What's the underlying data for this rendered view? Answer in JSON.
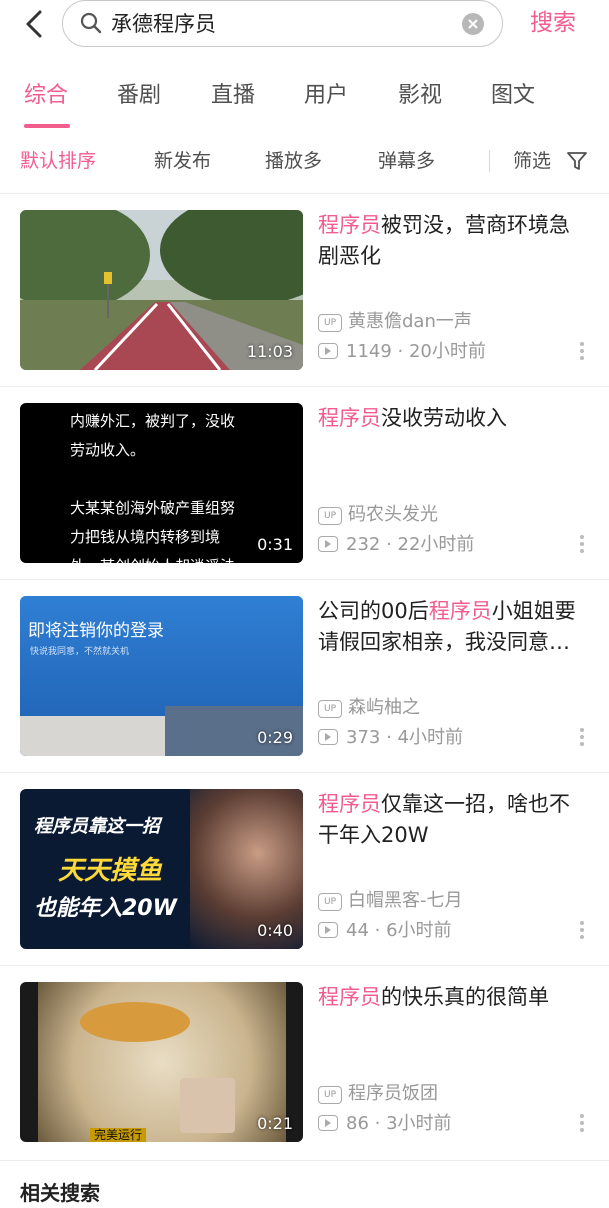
{
  "search": {
    "query": "承德程序员",
    "button_label": "搜索"
  },
  "tabs": [
    "综合",
    "番剧",
    "直播",
    "用户",
    "影视",
    "图文"
  ],
  "sort": {
    "options": [
      "默认排序",
      "新发布",
      "播放多",
      "弹幕多"
    ],
    "filter_label": "筛选"
  },
  "results": [
    {
      "title_highlight": "程序员",
      "title_rest": "被罚没，营商环境急剧恶化",
      "duration": "11:03",
      "uploader": "黄惠儋dan一声",
      "plays": "1149",
      "time": "20小时前"
    },
    {
      "title_highlight": "程序员",
      "title_rest": "没收劳动收入",
      "duration": "0:31",
      "uploader": "码农头发光",
      "plays": "232",
      "time": "22小时前",
      "thumb_text": [
        "内赚外汇，被判了，没收",
        "劳动收入。",
        "",
        "大某某创海外破产重组努",
        "力把钱从境内转移到境",
        "外，某创创始人却逍遥法"
      ]
    },
    {
      "title_prefix": "公司的00后",
      "title_highlight": "程序员",
      "title_rest": "小姐姐要请假回家相亲，我没同意她竟然...",
      "duration": "0:29",
      "uploader": "森屿柚之",
      "plays": "373",
      "time": "4小时前",
      "thumb_text": [
        "即将注销你的登录",
        "快说我同意，不然就关机"
      ]
    },
    {
      "title_highlight": "程序员",
      "title_rest": "仅靠这一招，啥也不干年入20W",
      "duration": "0:40",
      "uploader": "白帽黑客-七月",
      "plays": "44",
      "time": "6小时前",
      "thumb_text": [
        "程序员靠这一招",
        "天天摸鱼",
        "也能年入20W"
      ]
    },
    {
      "title_highlight": "程序员",
      "title_rest": "的快乐真的很简单",
      "duration": "0:21",
      "uploader": "程序员饭团",
      "plays": "86",
      "time": "3小时前",
      "thumb_text": [
        "完美运行"
      ]
    }
  ],
  "related_title": "相关搜索",
  "up_badge": "UP",
  "colors": {
    "accent": "#f25d8e",
    "meta": "#999999"
  }
}
